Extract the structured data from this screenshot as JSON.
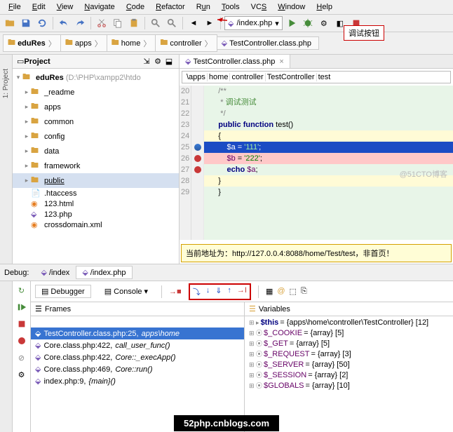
{
  "menu": {
    "items": [
      "File",
      "Edit",
      "View",
      "Navigate",
      "Code",
      "Refactor",
      "Run",
      "Tools",
      "VCS",
      "Window",
      "Help"
    ]
  },
  "run_config": "/index.php",
  "breadcrumb": [
    "eduRes",
    "apps",
    "home",
    "controller",
    "TestController.class.php"
  ],
  "project": {
    "title": "Project",
    "root": {
      "name": "eduRes",
      "path": "(D:\\PHP\\xampp2\\htdo"
    },
    "folders": [
      "_readme",
      "apps",
      "common",
      "config",
      "data",
      "framework",
      "public"
    ],
    "selected": "public",
    "files": [
      ".htaccess",
      "123.html",
      "123.php",
      "crossdomain.xml"
    ]
  },
  "editor": {
    "tab": "TestController.class.php",
    "path_segments": [
      "\\apps",
      "home",
      "controller",
      "TestController",
      "test"
    ],
    "lines": {
      "20": "   /**",
      "21": "    * 调试测试",
      "22": "    */",
      "23": "   public function test()",
      "24": "   {",
      "25": "       $a = '111';",
      "26": "       $b = '222';",
      "27": "       echo $a;",
      "28": "   }",
      "29": "}"
    },
    "message": "当前地址为：http://127.0.0.4:8088/home/Test/test，非首页！"
  },
  "debug": {
    "label": "Debug:",
    "tabs": [
      {
        "name": "/index"
      },
      {
        "name": "/index.php"
      }
    ],
    "active_tab": 1,
    "debugger_tab": "Debugger",
    "console_tab": "Console",
    "callout": "调试按钮",
    "frames": {
      "title": "Frames",
      "items": [
        {
          "text": "TestController.class.php:25,",
          "fi": "apps\\home",
          "sel": true
        },
        {
          "text": "Core.class.php:422,",
          "fi": "call_user_func()"
        },
        {
          "text": "Core.class.php:422,",
          "fi": "Core::_execApp()"
        },
        {
          "text": "Core.class.php:469,",
          "fi": "Core::run()"
        },
        {
          "text": "index.php:9,",
          "fi": "{main}()"
        }
      ]
    },
    "vars": {
      "title": "Variables",
      "items": [
        {
          "n": "$this",
          "v": "= {apps\\home\\controller\\TestController} [12]",
          "this": true
        },
        {
          "n": "$_COOKIE",
          "v": "= {array} [5]"
        },
        {
          "n": "$_GET",
          "v": "= {array} [5]"
        },
        {
          "n": "$_REQUEST",
          "v": "= {array} [3]"
        },
        {
          "n": "$_SERVER",
          "v": "= {array} [50]"
        },
        {
          "n": "$_SESSION",
          "v": "= {array} [2]"
        },
        {
          "n": "$GLOBALS",
          "v": "= {array} [10]"
        }
      ]
    }
  },
  "watermark": "@51CTO博客",
  "blackwm": "52php.cnblogs.com"
}
